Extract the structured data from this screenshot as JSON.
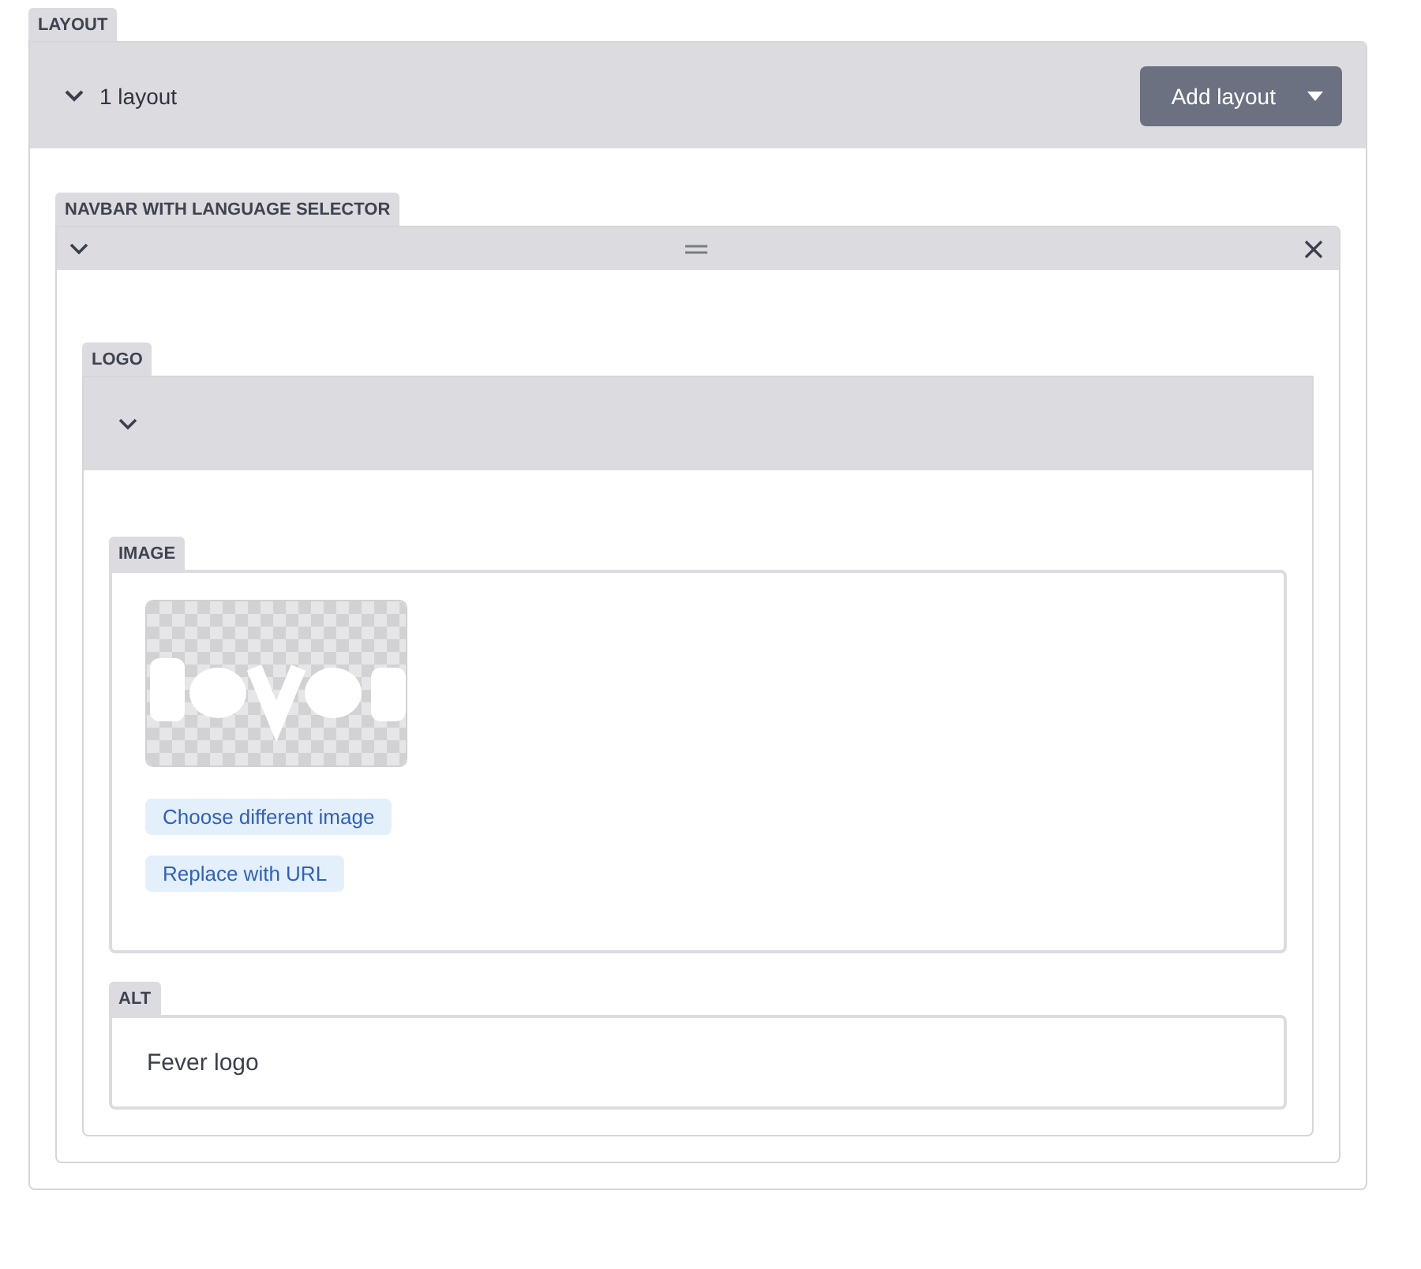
{
  "layout": {
    "label": "LAYOUT",
    "expanded": true,
    "summary": "1 layout",
    "add_button": "Add layout"
  },
  "block": {
    "label": "NAVBAR WITH LANGUAGE SELECTOR",
    "expanded": true
  },
  "logo": {
    "label": "LOGO",
    "expanded": true
  },
  "image": {
    "label": "IMAGE",
    "actions": [
      "Choose different image",
      "Replace with URL"
    ]
  },
  "alt": {
    "label": "ALT",
    "value": "Fever logo"
  }
}
